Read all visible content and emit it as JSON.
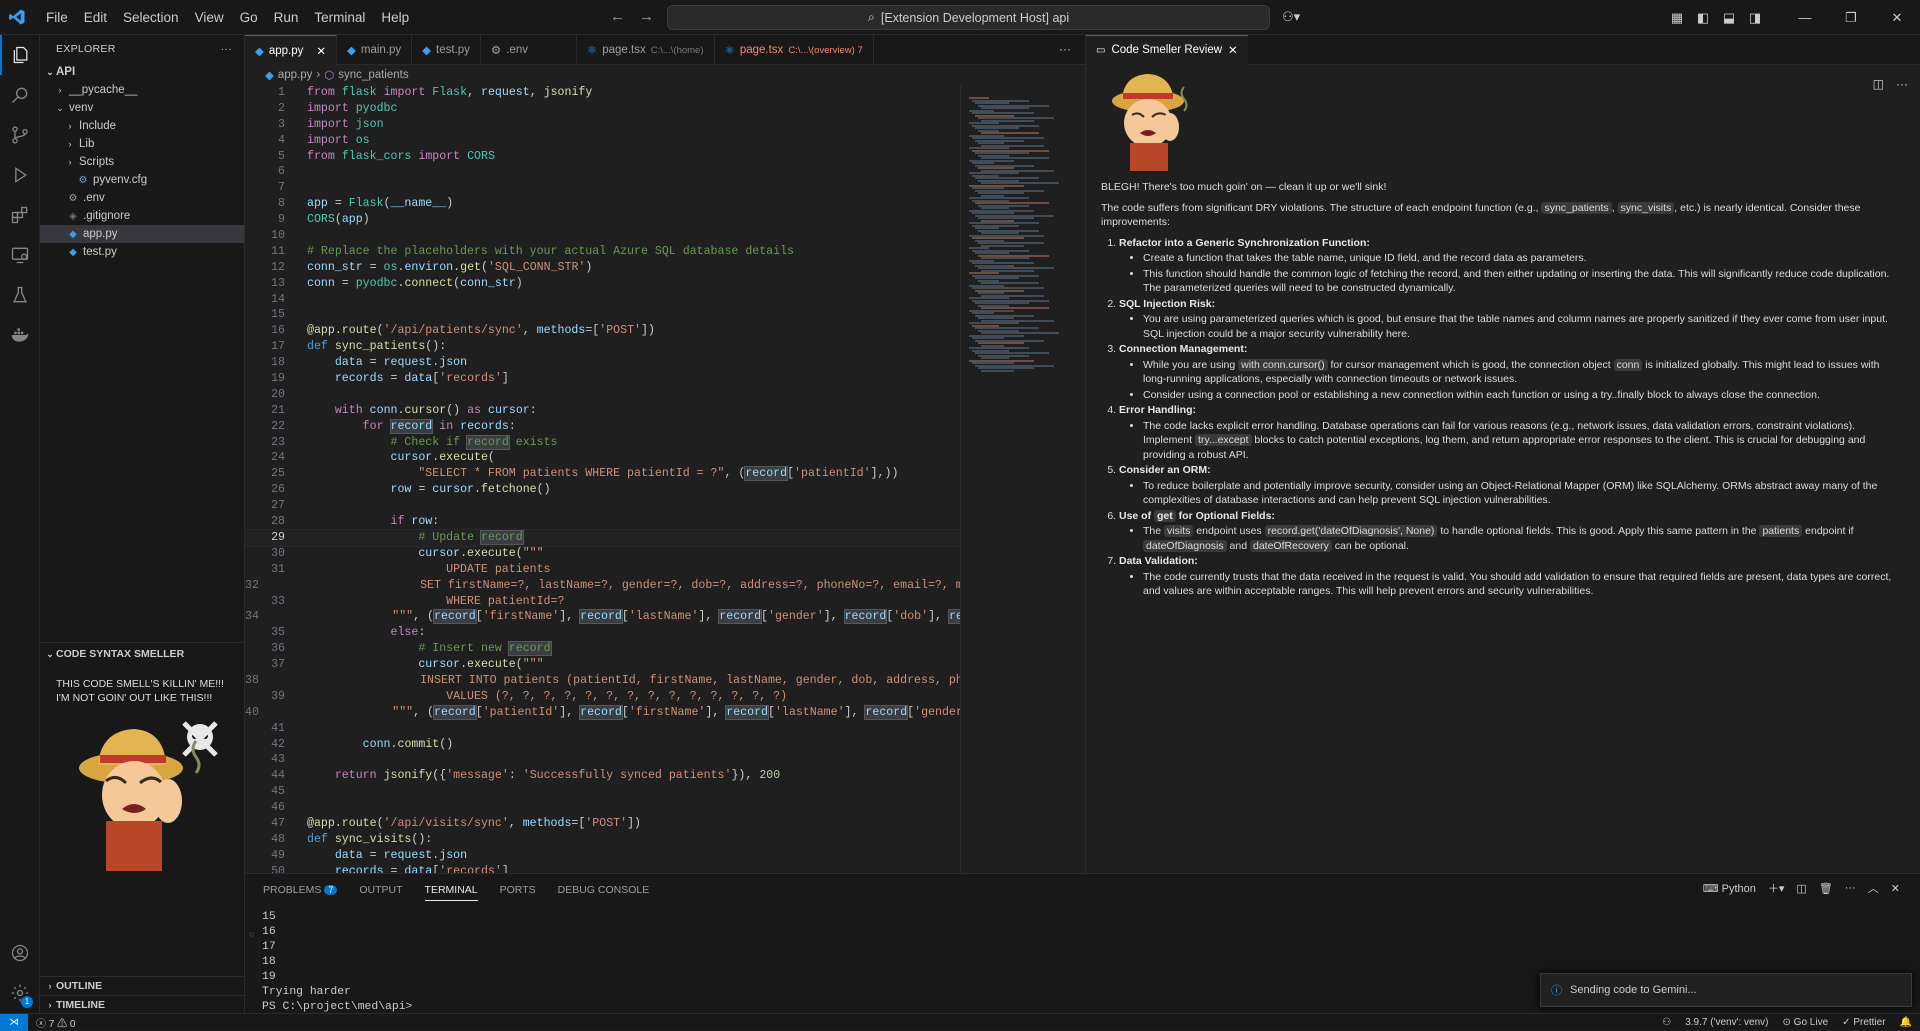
{
  "titlebar": {
    "menu": [
      "File",
      "Edit",
      "Selection",
      "View",
      "Go",
      "Run",
      "Terminal",
      "Help"
    ],
    "search": "[Extension Development Host] api"
  },
  "explorer": {
    "title": "EXPLORER",
    "root": "API",
    "items": [
      {
        "label": "__pycache__",
        "indent": 1,
        "type": "folder",
        "open": false
      },
      {
        "label": "venv",
        "indent": 1,
        "type": "folder",
        "open": true
      },
      {
        "label": "Include",
        "indent": 2,
        "type": "folder",
        "open": false
      },
      {
        "label": "Lib",
        "indent": 2,
        "type": "folder",
        "open": false
      },
      {
        "label": "Scripts",
        "indent": 2,
        "type": "folder",
        "open": false
      },
      {
        "label": "pyvenv.cfg",
        "indent": 2,
        "type": "file"
      },
      {
        "label": ".env",
        "indent": 1,
        "type": "file"
      },
      {
        "label": ".gitignore",
        "indent": 1,
        "type": "file"
      },
      {
        "label": "app.py",
        "indent": 1,
        "type": "file",
        "selected": true
      },
      {
        "label": "test.py",
        "indent": 1,
        "type": "file"
      }
    ],
    "smeller_title": "CODE SYNTAX SMELLER",
    "smeller_text_1": "THIS CODE SMELL'S KILLIN' ME!!!",
    "smeller_text_2": "I'M NOT GOIN' OUT LIKE THIS!!!",
    "outline": "OUTLINE",
    "timeline": "TIMELINE"
  },
  "tabs": [
    {
      "label": "app.py",
      "active": true
    },
    {
      "label": "main.py"
    },
    {
      "label": "test.py"
    },
    {
      "label": ".env"
    },
    {
      "label": "page.tsx",
      "sub": "C:\\...\\(home)"
    },
    {
      "label": "page.tsx",
      "sub": "C:\\...\\(overview) 7",
      "red": true
    }
  ],
  "breadcrumb": {
    "file": "app.py",
    "symbol": "sync_patients"
  },
  "review": {
    "tab": "Code Smeller Review",
    "intro": "BLEGH! There's too much goin' on — clean it up or we'll sink!",
    "summary_a": "The code suffers from significant DRY violations. The structure of each endpoint function (e.g., ",
    "summary_c1": "sync_patients",
    "summary_b": ", ",
    "summary_c2": "sync_visits",
    "summary_d": ", etc.) is nearly identical. Consider these improvements:",
    "i1_title": "Refactor into a Generic Synchronization Function:",
    "i1_b1": "Create a function that takes the table name, unique ID field, and the record data as parameters.",
    "i1_b2": "This function should handle the common logic of fetching the record, and then either updating or inserting the data. This will significantly reduce code duplication. The parameterized queries will need to be constructed dynamically.",
    "i2_title": "SQL Injection Risk:",
    "i2_b1": "You are using parameterized queries which is good, but ensure that the table names and column names are properly sanitized if they ever come from user input. SQL injection could be a major security vulnerability here.",
    "i3_title": "Connection Management:",
    "i3_b1a": "While you are using ",
    "i3_b1c1": "with conn.cursor()",
    "i3_b1b": " for cursor management which is good, the connection object ",
    "i3_b1c2": "conn",
    "i3_b1d": " is initialized globally. This might lead to issues with long-running applications, especially with connection timeouts or network issues.",
    "i3_b2": "Consider using a connection pool or establishing a new connection within each function or using a try..finally block to always close the connection.",
    "i4_title": "Error Handling:",
    "i4_b1a": "The code lacks explicit error handling. Database operations can fail for various reasons (e.g., network issues, data validation errors, constraint violations). Implement ",
    "i4_b1c": "try...except",
    "i4_b1b": " blocks to catch potential exceptions, log them, and return appropriate error responses to the client. This is crucial for debugging and providing a robust API.",
    "i5_title": "Consider an ORM:",
    "i5_b1": "To reduce boilerplate and potentially improve security, consider using an Object-Relational Mapper (ORM) like SQLAlchemy. ORMs abstract away many of the complexities of database interactions and can help prevent SQL injection vulnerabilities.",
    "i6_title_a": "Use of ",
    "i6_title_c": "get",
    "i6_title_b": " for Optional Fields:",
    "i6_b1a": "The ",
    "i6_b1c1": "visits",
    "i6_b1b": " endpoint uses ",
    "i6_b1c2": "record.get('dateOfDiagnosis', None)",
    "i6_b1d": " to handle optional fields. This is good. Apply this same pattern in the ",
    "i6_b1c3": "patients",
    "i6_b1e": " endpoint if ",
    "i6_b1c4": "dateOfDiagnosis",
    "i6_b1f": " and ",
    "i6_b1c5": "dateOfRecovery",
    "i6_b1g": " can be optional.",
    "i7_title": "Data Validation:",
    "i7_b1": "The code currently trusts that the data received in the request is valid. You should add validation to ensure that required fields are present, data types are correct, and values are within acceptable ranges. This will help prevent errors and security vulnerabilities."
  },
  "panel": {
    "tabs": [
      "PROBLEMS",
      "OUTPUT",
      "TERMINAL",
      "PORTS",
      "DEBUG CONSOLE"
    ],
    "problems_count": "7",
    "active": "TERMINAL",
    "shell": "Python",
    "lines": [
      "15",
      "16",
      "17",
      "18",
      "19",
      "Trying harder",
      "PS C:\\project\\med\\api>"
    ]
  },
  "toast": "Sending code to Gemini...",
  "status": {
    "errors": "7",
    "warnings": "0",
    "python": "3.9.7 ('venv': venv)",
    "golive": "Go Live",
    "prettier": "Prettier"
  },
  "colors": {
    "accent": "#0078d4",
    "bg": "#1f1f1f"
  }
}
